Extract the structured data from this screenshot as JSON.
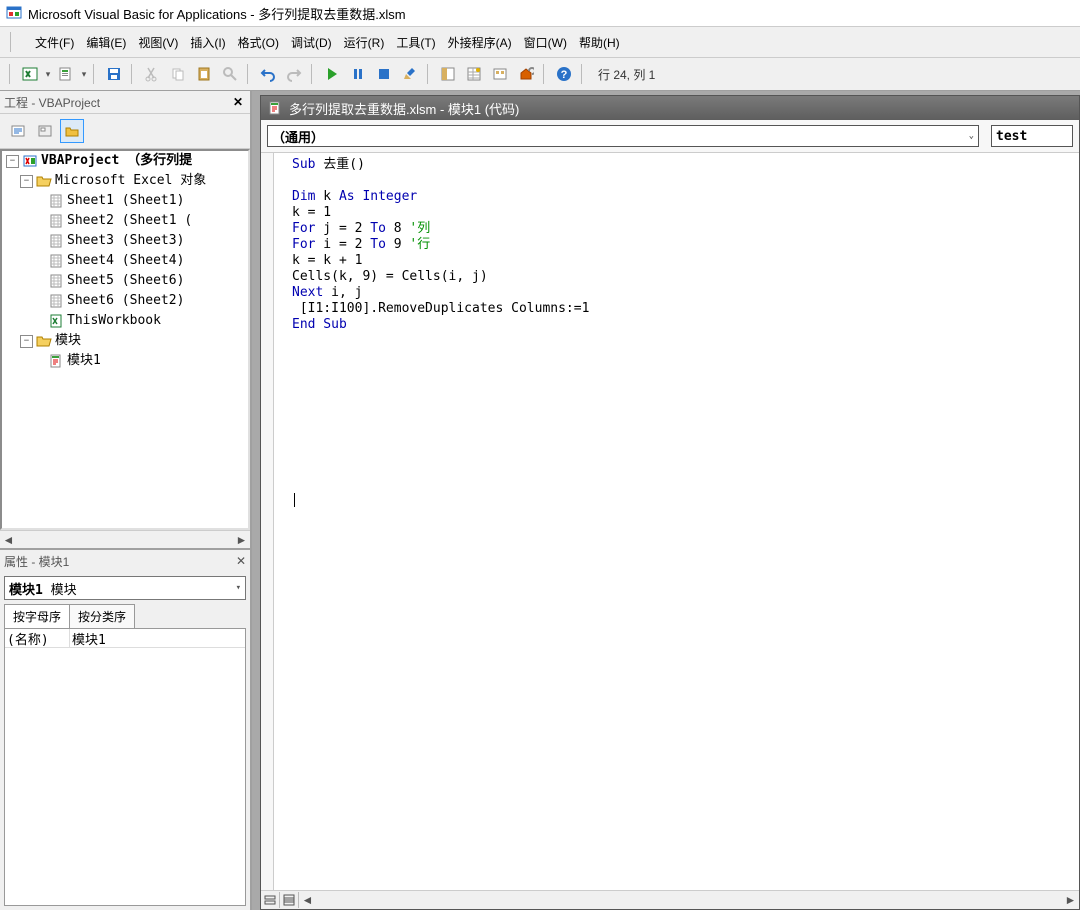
{
  "app": {
    "title": "Microsoft Visual Basic for Applications - 多行列提取去重数据.xlsm"
  },
  "menu": {
    "file": "文件(F)",
    "edit": "编辑(E)",
    "view": "视图(V)",
    "insert": "插入(I)",
    "format": "格式(O)",
    "debug": "调试(D)",
    "run": "运行(R)",
    "tools": "工具(T)",
    "addins": "外接程序(A)",
    "window": "窗口(W)",
    "help": "帮助(H)"
  },
  "toolbar_status": "行 24, 列 1",
  "project_panel": {
    "title": "工程 - VBAProject",
    "root": "VBAProject （多行列提",
    "excel_objects": "Microsoft Excel 对象",
    "sheets": [
      "Sheet1 (Sheet1)",
      "Sheet2 (Sheet1 (",
      "Sheet3 (Sheet3)",
      "Sheet4 (Sheet4)",
      "Sheet5 (Sheet6)",
      "Sheet6 (Sheet2)"
    ],
    "this_workbook": "ThisWorkbook",
    "modules_folder": "模块",
    "module1": "模块1"
  },
  "props_panel": {
    "title": "属性 - 模块1",
    "combo_bold": "模块1",
    "combo_rest": " 模块",
    "tab_alpha": "按字母序",
    "tab_cat": "按分类序",
    "name_label": "(名称)",
    "name_value": "模块1"
  },
  "code_window": {
    "title": "多行列提取去重数据.xlsm - 模块1 (代码)",
    "combo_object": "（通用）",
    "combo_proc": "test",
    "lines": [
      {
        "kw1": "Sub",
        "txt": " 去重()"
      },
      {
        "txt": ""
      },
      {
        "kw1": "Dim",
        "txt": " k ",
        "kw2": "As Integer"
      },
      {
        "txt": "k = 1"
      },
      {
        "kw1": "For",
        "txt": " j = 2 ",
        "kw2": "To",
        "txt2": " 8 ",
        "cm": "'列"
      },
      {
        "kw1": "For",
        "txt": " i = 2 ",
        "kw2": "To",
        "txt2": " 9 ",
        "cm": "'行"
      },
      {
        "txt": "k = k + 1"
      },
      {
        "txt": "Cells(k, 9) = Cells(i, j)"
      },
      {
        "kw1": "Next",
        "txt": " i, j"
      },
      {
        "txt": " [I1:I100].RemoveDuplicates Columns:=1"
      },
      {
        "kw1": "End Sub"
      }
    ]
  }
}
